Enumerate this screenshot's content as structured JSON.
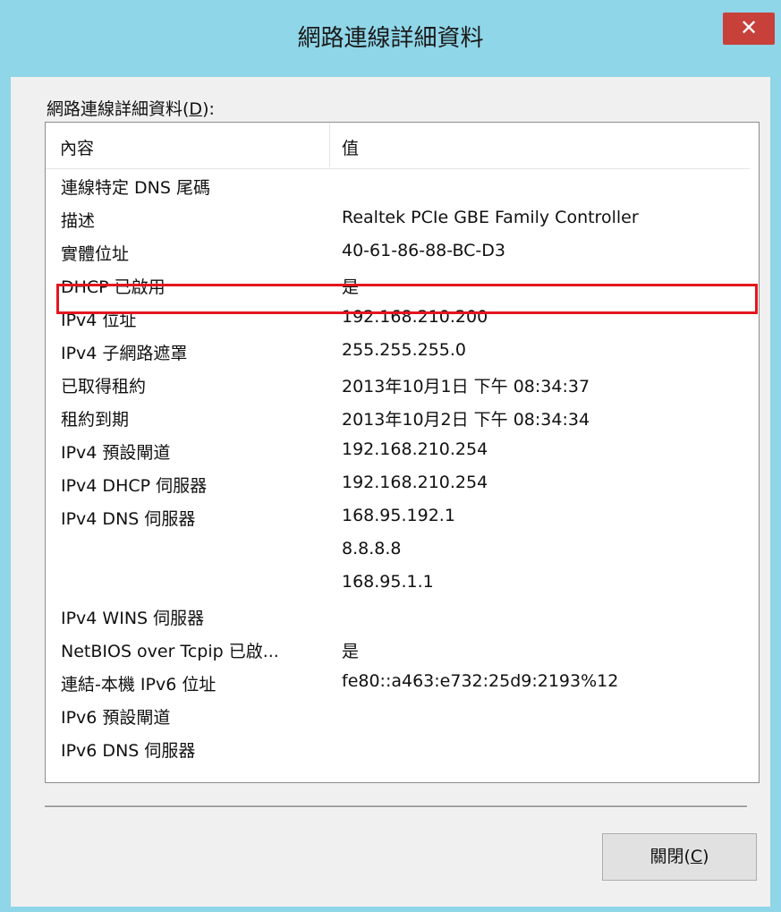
{
  "window": {
    "title": "網路連線詳細資料",
    "close_icon_glyph": "✕"
  },
  "group": {
    "label": "網路連線詳細資料(",
    "accelerator": "D",
    "label_suffix": "):"
  },
  "list": {
    "headers": [
      "內容",
      "值"
    ],
    "rows": [
      {
        "prop": "連線特定 DNS 尾碼",
        "value": ""
      },
      {
        "prop": "描述",
        "value": "Realtek PCIe GBE Family Controller"
      },
      {
        "prop": "實體位址",
        "value": "40-61-86-88-BC-D3"
      },
      {
        "prop": "DHCP 已啟用",
        "value": "是"
      },
      {
        "prop": "IPv4 位址",
        "value": "192.168.210.200"
      },
      {
        "prop": "IPv4 子網路遮罩",
        "value": "255.255.255.0"
      },
      {
        "prop": "已取得租約",
        "value": "2013年10月1日 下午 08:34:37"
      },
      {
        "prop": "租約到期",
        "value": "2013年10月2日 下午 08:34:34"
      },
      {
        "prop": "IPv4 預設閘道",
        "value": "192.168.210.254"
      },
      {
        "prop": "IPv4 DHCP 伺服器",
        "value": "192.168.210.254"
      },
      {
        "prop": "IPv4 DNS 伺服器",
        "value": "168.95.192.1"
      },
      {
        "prop": "",
        "value": "8.8.8.8"
      },
      {
        "prop": "",
        "value": "168.95.1.1"
      },
      {
        "prop": "IPv4 WINS 伺服器",
        "value": ""
      },
      {
        "prop": "NetBIOS over Tcpip 已啟...",
        "value": "是"
      },
      {
        "prop": "連結-本機 IPv6 位址",
        "value": "fe80::a463:e732:25d9:2193%12"
      },
      {
        "prop": "IPv6 預設閘道",
        "value": ""
      },
      {
        "prop": "IPv6 DNS 伺服器",
        "value": ""
      }
    ],
    "highlight_color": "#e4161d"
  },
  "buttons": {
    "close_label": "關閉(",
    "close_accelerator": "C",
    "close_suffix": ")"
  }
}
